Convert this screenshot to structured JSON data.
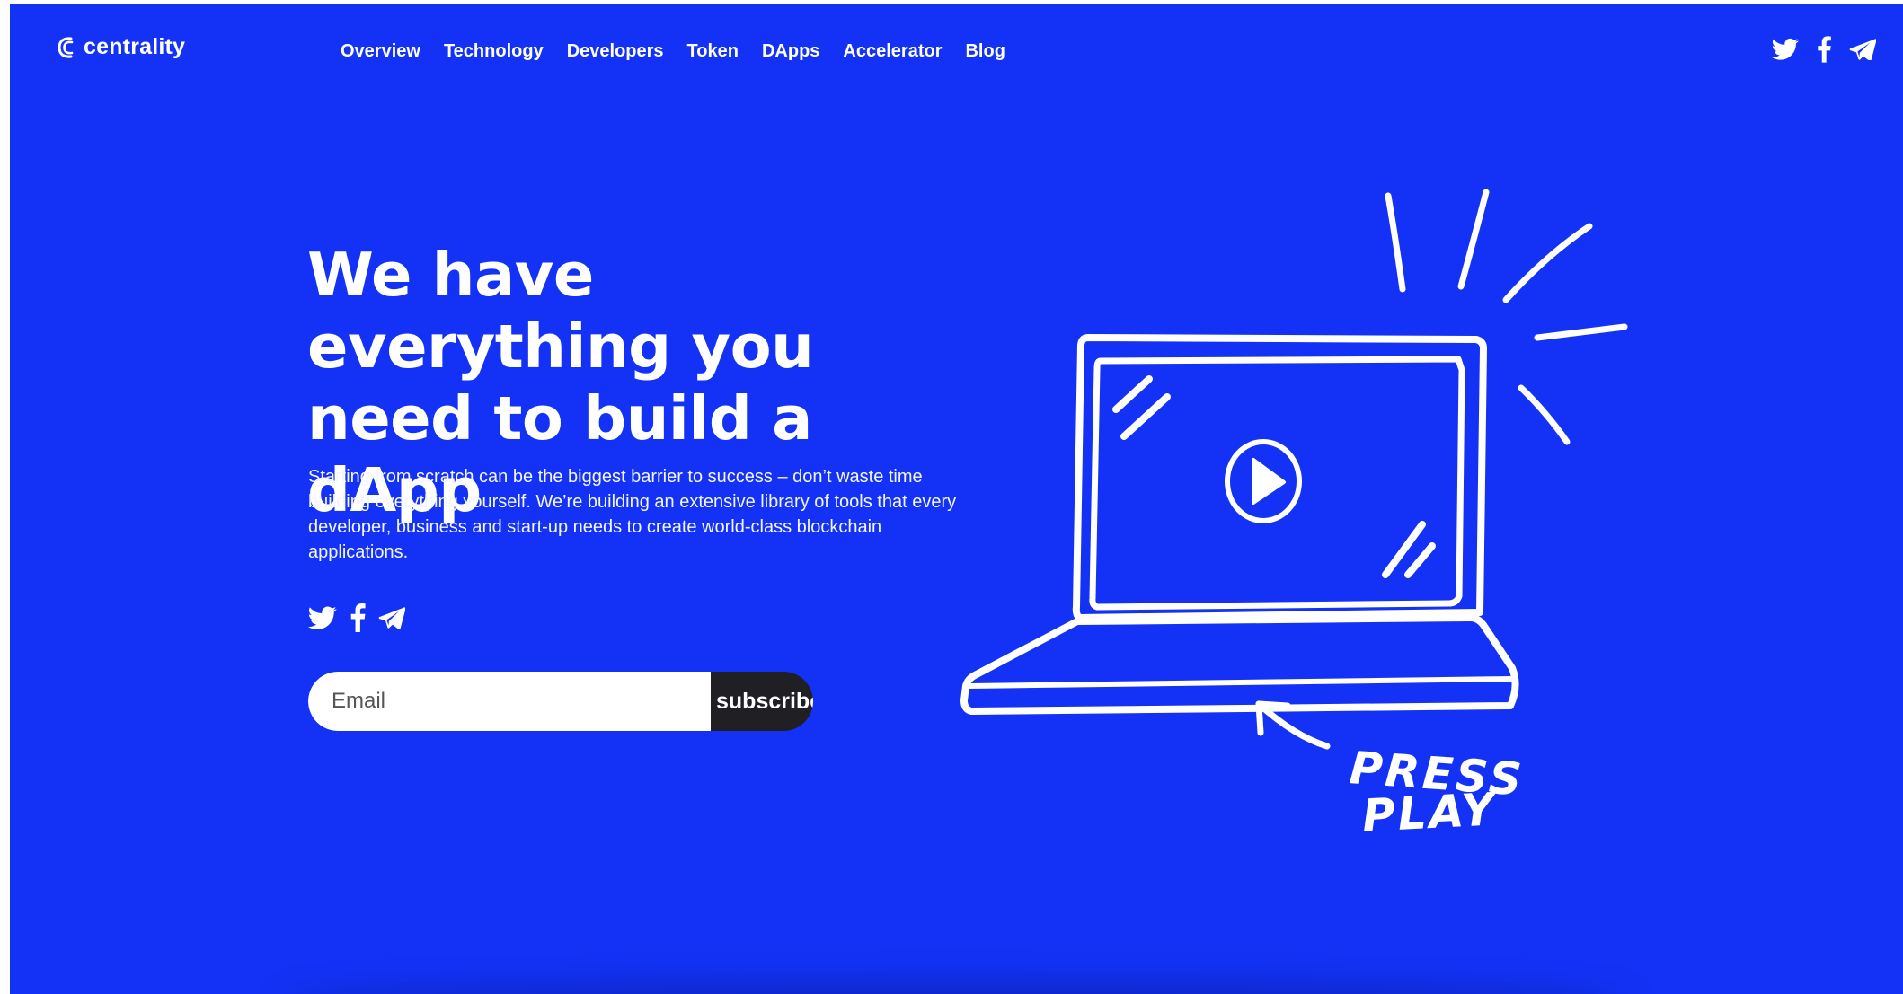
{
  "brand": {
    "name": "centrality"
  },
  "nav": {
    "items": [
      {
        "label": "Overview"
      },
      {
        "label": "Technology"
      },
      {
        "label": "Developers"
      },
      {
        "label": "Token"
      },
      {
        "label": "DApps"
      },
      {
        "label": "Accelerator"
      },
      {
        "label": "Blog"
      }
    ]
  },
  "header_social": [
    "twitter-icon",
    "facebook-icon",
    "telegram-icon"
  ],
  "hero": {
    "title": "We have everything you need to build a dApp",
    "description": "Starting from scratch can be the biggest barrier to success – don’t waste time building everything yourself. We’re building an extensive library of tools that every developer, business and start-up needs to create world-class blockchain applications.",
    "social": [
      "twitter-icon",
      "facebook-icon",
      "telegram-icon"
    ]
  },
  "subscribe": {
    "email_placeholder": "Email",
    "email_value": "",
    "button_label": "subscribe"
  },
  "illustration": {
    "handwritten_line1": "PRESS",
    "handwritten_line2": "PLAY"
  },
  "colors": {
    "background": "#1332f5",
    "text": "#ffffff",
    "button": "#1f1f24"
  }
}
